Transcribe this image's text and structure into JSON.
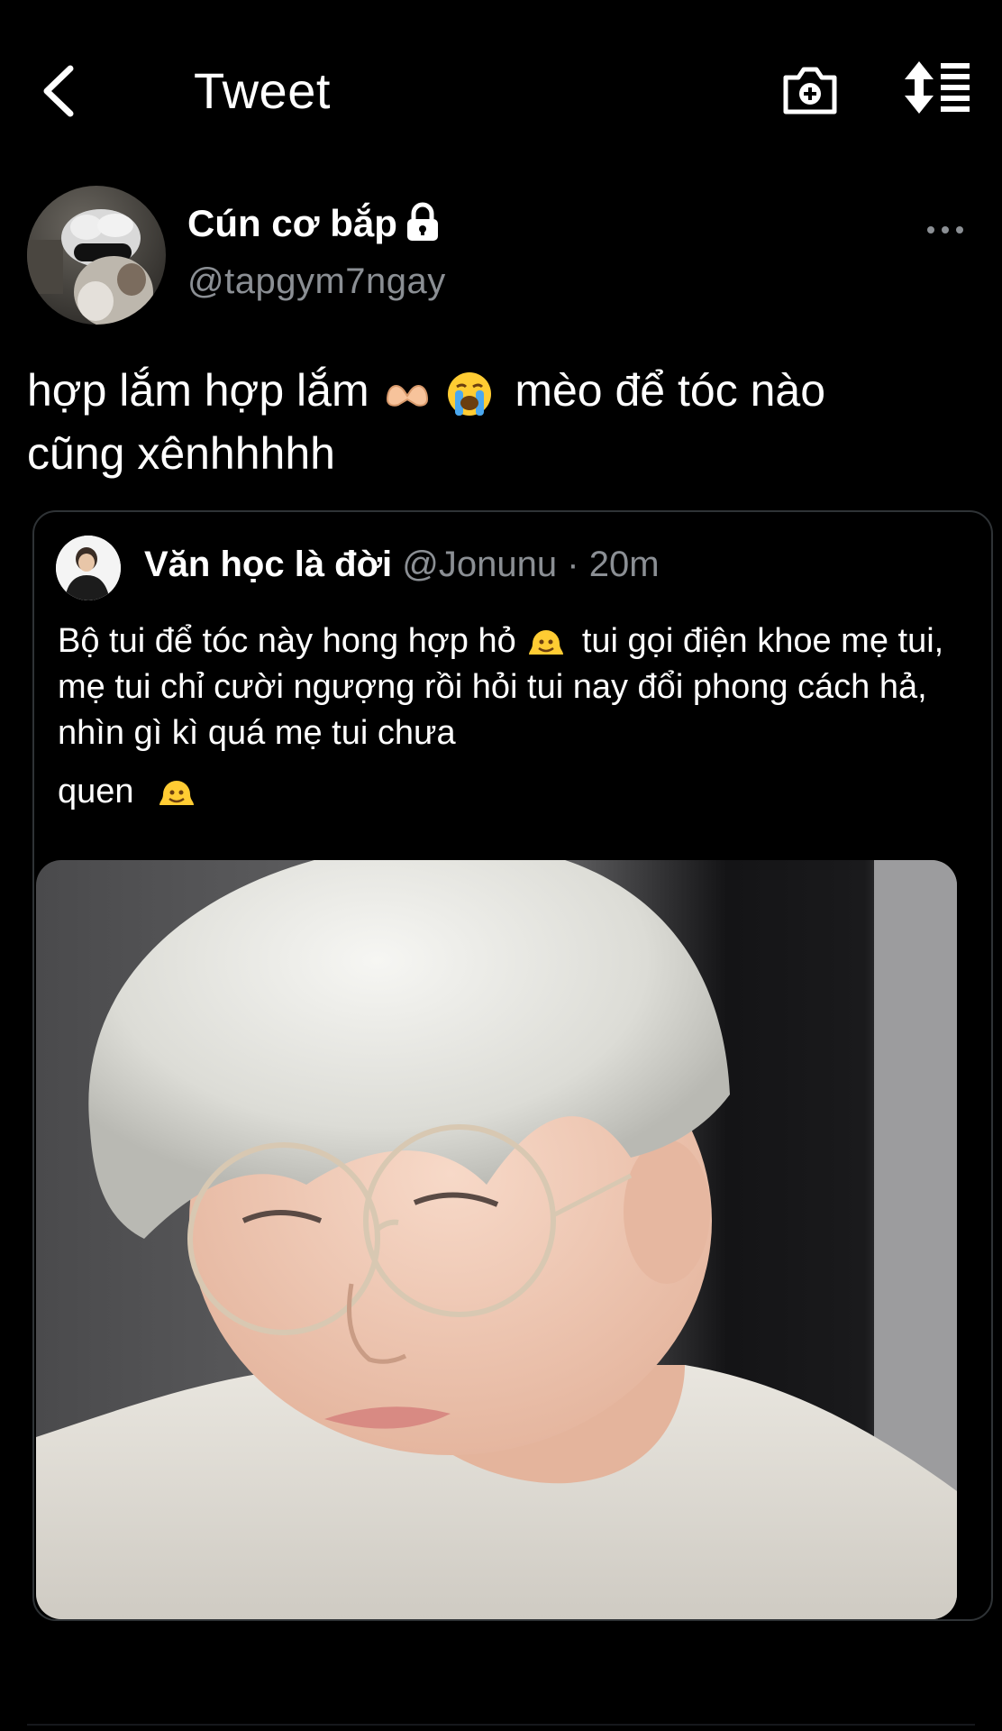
{
  "header": {
    "title": "Tweet",
    "icons": [
      "back-chevron-icon",
      "camera-add-icon",
      "sort-list-icon"
    ]
  },
  "tweet": {
    "author": {
      "display_name": "Cún cơ bắp",
      "handle": "@tapgym7ngay",
      "protected_icon": "lock-icon"
    },
    "more_icon": "more-horizontal-icon",
    "text_line1_part1": "hợp lắm hợp lắm",
    "text_line1_part2": "mèo để tóc nào",
    "text_line2": "cũng xênhhhhh",
    "emojis": [
      "heart-hands-emoji",
      "loudly-crying-face-emoji"
    ]
  },
  "quoted_tweet": {
    "display_name": "Văn học là đời",
    "handle": "@Jonunu",
    "separator": "·",
    "time": "20m",
    "text_part1": "Bộ tui để tóc này hong hợp hỏ",
    "text_part2": "tui gọi điện khoe mẹ tui, mẹ tui chỉ cười ngượng rồi hỏi tui nay đổi phong cách hả, nhìn gì kì quá mẹ tui chưa",
    "text_part3": "quen",
    "emojis": [
      "melting-face-emoji",
      "melting-face-emoji"
    ],
    "image": "photo-white-haired-person-glasses"
  },
  "colors": {
    "background": "#000000",
    "text_primary": "#ffffff",
    "text_secondary": "#8b8f94",
    "border": "#2f3336"
  }
}
